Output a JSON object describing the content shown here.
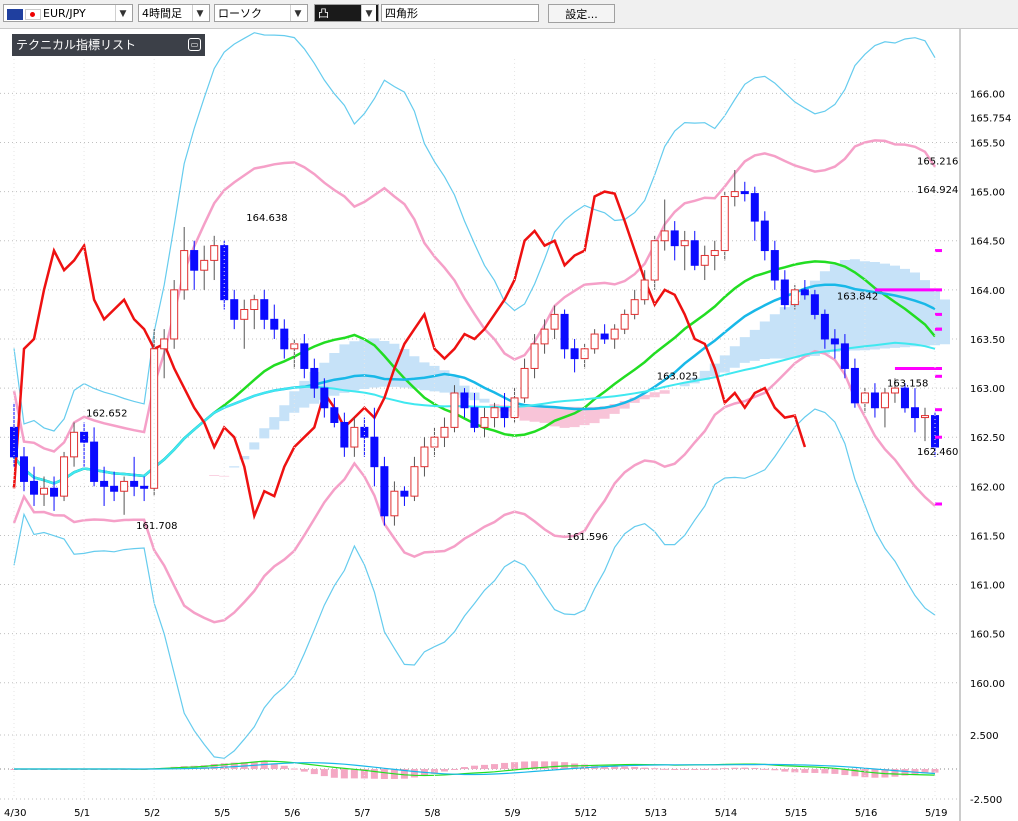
{
  "toolbar": {
    "symbol": "EUR/JPY",
    "timeframe": "4時間足",
    "chart_type": "ローソク",
    "drawing_tool": "凸",
    "shape": "四角形",
    "settings_label": "設定..."
  },
  "panel": {
    "indicator_list_label": "テクニカル指標リスト"
  },
  "colors": {
    "up_body": "#ffffff",
    "up_border": "#e03030",
    "down_body": "#0a0aff",
    "bollinger_outer": "#66ccee",
    "bollinger_inner": "#f5a0c8",
    "ma_green": "#22dd22",
    "ma_cyan": "#18b8e8",
    "ma_cyan_long": "#40e8f0",
    "line_red": "#ee1111",
    "magenta": "#ff00ff",
    "cloud_up": "#c6e2f8",
    "cloud_down": "#f8c4d8"
  },
  "chart_data": {
    "type": "candlestick",
    "symbol": "EUR/JPY",
    "ylim": [
      159.55,
      166.35
    ],
    "y_ticks": [
      "166.00",
      "165.50",
      "165.00",
      "164.50",
      "164.00",
      "163.50",
      "163.00",
      "162.50",
      "162.00",
      "161.50",
      "161.00",
      "160.50",
      "160.00"
    ],
    "last_price_label": "165.754",
    "x_labels": [
      "4/30",
      "5/1",
      "5/2",
      "5/5",
      "5/6",
      "5/7",
      "5/8",
      "5/9",
      "5/12",
      "5/13",
      "5/14",
      "5/15",
      "5/16",
      "5/19"
    ],
    "annotations": [
      {
        "text": "162.652",
        "x": 9,
        "y": 162.652,
        "pos": "above"
      },
      {
        "text": "161.708",
        "x": 14,
        "y": 161.708,
        "pos": "below"
      },
      {
        "text": "164.638",
        "x": 25,
        "y": 164.638,
        "pos": "above"
      },
      {
        "text": "161.596",
        "x": 57,
        "y": 161.596,
        "pos": "below"
      },
      {
        "text": "163.025",
        "x": 66,
        "y": 163.025,
        "pos": "above"
      },
      {
        "text": "163.842",
        "x": 84,
        "y": 163.842,
        "pos": "above"
      },
      {
        "text": "163.158",
        "x": 89,
        "y": 163.158,
        "pos": "below"
      },
      {
        "text": "164.924",
        "x": 105,
        "y": 164.924,
        "pos": "above"
      },
      {
        "text": "165.216",
        "x": 116,
        "y": 165.216,
        "pos": "above"
      },
      {
        "text": "162.460",
        "x": 139,
        "y": 162.46,
        "pos": "below"
      }
    ],
    "candles": [
      {
        "o": 162.6,
        "h": 162.85,
        "l": 162.2,
        "c": 162.3
      },
      {
        "o": 162.3,
        "h": 162.4,
        "l": 161.95,
        "c": 162.05
      },
      {
        "o": 162.05,
        "h": 162.2,
        "l": 161.8,
        "c": 161.92
      },
      {
        "o": 161.92,
        "h": 162.1,
        "l": 161.8,
        "c": 161.98
      },
      {
        "o": 161.98,
        "h": 162.1,
        "l": 161.75,
        "c": 161.9
      },
      {
        "o": 161.9,
        "h": 162.35,
        "l": 161.85,
        "c": 162.3
      },
      {
        "o": 162.3,
        "h": 162.65,
        "l": 162.2,
        "c": 162.55
      },
      {
        "o": 162.55,
        "h": 162.65,
        "l": 162.2,
        "c": 162.45
      },
      {
        "o": 162.45,
        "h": 162.6,
        "l": 162.0,
        "c": 162.05
      },
      {
        "o": 162.05,
        "h": 162.2,
        "l": 161.8,
        "c": 162.0
      },
      {
        "o": 162.0,
        "h": 162.15,
        "l": 161.85,
        "c": 161.95
      },
      {
        "o": 161.95,
        "h": 162.1,
        "l": 161.71,
        "c": 162.05
      },
      {
        "o": 162.05,
        "h": 162.3,
        "l": 161.9,
        "c": 162.0
      },
      {
        "o": 162.0,
        "h": 162.1,
        "l": 161.85,
        "c": 161.98
      },
      {
        "o": 161.98,
        "h": 163.6,
        "l": 161.9,
        "c": 163.4
      },
      {
        "o": 163.4,
        "h": 163.6,
        "l": 163.1,
        "c": 163.5
      },
      {
        "o": 163.5,
        "h": 164.1,
        "l": 163.4,
        "c": 164.0
      },
      {
        "o": 164.0,
        "h": 164.64,
        "l": 163.9,
        "c": 164.4
      },
      {
        "o": 164.4,
        "h": 164.5,
        "l": 164.0,
        "c": 164.2
      },
      {
        "o": 164.2,
        "h": 164.45,
        "l": 164.0,
        "c": 164.3
      },
      {
        "o": 164.3,
        "h": 164.55,
        "l": 164.1,
        "c": 164.45
      },
      {
        "o": 164.45,
        "h": 164.5,
        "l": 163.8,
        "c": 163.9
      },
      {
        "o": 163.9,
        "h": 164.0,
        "l": 163.6,
        "c": 163.7
      },
      {
        "o": 163.7,
        "h": 163.9,
        "l": 163.4,
        "c": 163.8
      },
      {
        "o": 163.8,
        "h": 163.95,
        "l": 163.6,
        "c": 163.9
      },
      {
        "o": 163.9,
        "h": 164.0,
        "l": 163.6,
        "c": 163.7
      },
      {
        "o": 163.7,
        "h": 163.85,
        "l": 163.5,
        "c": 163.6
      },
      {
        "o": 163.6,
        "h": 163.7,
        "l": 163.3,
        "c": 163.4
      },
      {
        "o": 163.4,
        "h": 163.5,
        "l": 163.2,
        "c": 163.45
      },
      {
        "o": 163.45,
        "h": 163.55,
        "l": 163.1,
        "c": 163.2
      },
      {
        "o": 163.2,
        "h": 163.3,
        "l": 162.9,
        "c": 163.0
      },
      {
        "o": 163.0,
        "h": 163.1,
        "l": 162.7,
        "c": 162.8
      },
      {
        "o": 162.8,
        "h": 162.9,
        "l": 162.6,
        "c": 162.65
      },
      {
        "o": 162.65,
        "h": 162.75,
        "l": 162.3,
        "c": 162.4
      },
      {
        "o": 162.4,
        "h": 162.7,
        "l": 162.3,
        "c": 162.6
      },
      {
        "o": 162.6,
        "h": 162.7,
        "l": 162.3,
        "c": 162.5
      },
      {
        "o": 162.5,
        "h": 162.8,
        "l": 162.0,
        "c": 162.2
      },
      {
        "o": 162.2,
        "h": 162.3,
        "l": 161.6,
        "c": 161.7
      },
      {
        "o": 161.7,
        "h": 162.05,
        "l": 161.6,
        "c": 161.95
      },
      {
        "o": 161.95,
        "h": 162.0,
        "l": 161.8,
        "c": 161.9
      },
      {
        "o": 161.9,
        "h": 162.3,
        "l": 161.85,
        "c": 162.2
      },
      {
        "o": 162.2,
        "h": 162.5,
        "l": 162.1,
        "c": 162.4
      },
      {
        "o": 162.4,
        "h": 162.6,
        "l": 162.3,
        "c": 162.5
      },
      {
        "o": 162.5,
        "h": 162.7,
        "l": 162.4,
        "c": 162.6
      },
      {
        "o": 162.6,
        "h": 163.03,
        "l": 162.55,
        "c": 162.95
      },
      {
        "o": 162.95,
        "h": 163.0,
        "l": 162.7,
        "c": 162.8
      },
      {
        "o": 162.8,
        "h": 162.95,
        "l": 162.55,
        "c": 162.6
      },
      {
        "o": 162.6,
        "h": 162.8,
        "l": 162.5,
        "c": 162.7
      },
      {
        "o": 162.7,
        "h": 162.85,
        "l": 162.6,
        "c": 162.8
      },
      {
        "o": 162.8,
        "h": 162.95,
        "l": 162.6,
        "c": 162.7
      },
      {
        "o": 162.7,
        "h": 163.0,
        "l": 162.65,
        "c": 162.9
      },
      {
        "o": 162.9,
        "h": 163.3,
        "l": 162.85,
        "c": 163.2
      },
      {
        "o": 163.2,
        "h": 163.55,
        "l": 163.1,
        "c": 163.45
      },
      {
        "o": 163.45,
        "h": 163.7,
        "l": 163.35,
        "c": 163.6
      },
      {
        "o": 163.6,
        "h": 163.84,
        "l": 163.5,
        "c": 163.75
      },
      {
        "o": 163.75,
        "h": 163.8,
        "l": 163.3,
        "c": 163.4
      },
      {
        "o": 163.4,
        "h": 163.5,
        "l": 163.16,
        "c": 163.3
      },
      {
        "o": 163.3,
        "h": 163.45,
        "l": 163.2,
        "c": 163.4
      },
      {
        "o": 163.4,
        "h": 163.6,
        "l": 163.35,
        "c": 163.55
      },
      {
        "o": 163.55,
        "h": 163.65,
        "l": 163.45,
        "c": 163.5
      },
      {
        "o": 163.5,
        "h": 163.65,
        "l": 163.4,
        "c": 163.6
      },
      {
        "o": 163.6,
        "h": 163.8,
        "l": 163.55,
        "c": 163.75
      },
      {
        "o": 163.75,
        "h": 164.0,
        "l": 163.7,
        "c": 163.9
      },
      {
        "o": 163.9,
        "h": 164.2,
        "l": 163.85,
        "c": 164.1
      },
      {
        "o": 164.1,
        "h": 164.55,
        "l": 164.0,
        "c": 164.5
      },
      {
        "o": 164.5,
        "h": 164.92,
        "l": 164.4,
        "c": 164.6
      },
      {
        "o": 164.6,
        "h": 164.7,
        "l": 164.3,
        "c": 164.45
      },
      {
        "o": 164.45,
        "h": 164.6,
        "l": 164.2,
        "c": 164.5
      },
      {
        "o": 164.5,
        "h": 164.6,
        "l": 164.2,
        "c": 164.25
      },
      {
        "o": 164.25,
        "h": 164.45,
        "l": 164.1,
        "c": 164.35
      },
      {
        "o": 164.35,
        "h": 164.5,
        "l": 164.2,
        "c": 164.4
      },
      {
        "o": 164.4,
        "h": 165.0,
        "l": 164.3,
        "c": 164.95
      },
      {
        "o": 164.95,
        "h": 165.22,
        "l": 164.85,
        "c": 165.0
      },
      {
        "o": 165.0,
        "h": 165.1,
        "l": 164.9,
        "c": 164.98
      },
      {
        "o": 164.98,
        "h": 165.05,
        "l": 164.5,
        "c": 164.7
      },
      {
        "o": 164.7,
        "h": 164.8,
        "l": 164.3,
        "c": 164.4
      },
      {
        "o": 164.4,
        "h": 164.5,
        "l": 164.0,
        "c": 164.1
      },
      {
        "o": 164.1,
        "h": 164.2,
        "l": 163.8,
        "c": 163.85
      },
      {
        "o": 163.85,
        "h": 164.05,
        "l": 163.8,
        "c": 164.0
      },
      {
        "o": 164.0,
        "h": 164.1,
        "l": 163.9,
        "c": 163.95
      },
      {
        "o": 163.95,
        "h": 164.0,
        "l": 163.7,
        "c": 163.75
      },
      {
        "o": 163.75,
        "h": 163.8,
        "l": 163.4,
        "c": 163.5
      },
      {
        "o": 163.5,
        "h": 163.6,
        "l": 163.3,
        "c": 163.45
      },
      {
        "o": 163.45,
        "h": 163.55,
        "l": 163.1,
        "c": 163.2
      },
      {
        "o": 163.2,
        "h": 163.3,
        "l": 162.8,
        "c": 162.85
      },
      {
        "o": 162.85,
        "h": 163.0,
        "l": 162.75,
        "c": 162.95
      },
      {
        "o": 162.95,
        "h": 163.05,
        "l": 162.7,
        "c": 162.8
      },
      {
        "o": 162.8,
        "h": 163.0,
        "l": 162.6,
        "c": 162.95
      },
      {
        "o": 162.95,
        "h": 163.1,
        "l": 162.85,
        "c": 163.0
      },
      {
        "o": 163.0,
        "h": 163.05,
        "l": 162.75,
        "c": 162.8
      },
      {
        "o": 162.8,
        "h": 163.0,
        "l": 162.55,
        "c": 162.7
      },
      {
        "o": 162.7,
        "h": 162.8,
        "l": 162.46,
        "c": 162.72
      },
      {
        "o": 162.72,
        "h": 162.75,
        "l": 162.3,
        "c": 162.4
      }
    ],
    "oscillator": {
      "ylim": [
        -2.5,
        2.5
      ],
      "ticks": [
        "2.500",
        "-2.500"
      ]
    }
  }
}
